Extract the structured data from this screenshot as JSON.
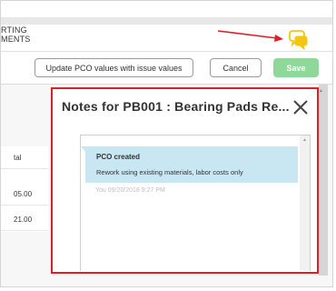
{
  "header": {
    "nav_line_1": "RTING",
    "nav_line_2": "MENTS"
  },
  "toolbar": {
    "update_label": "Update PCO values with issue values",
    "cancel_label": "Cancel",
    "save_label": "Save"
  },
  "background_table": {
    "header": "tal",
    "rows": [
      "05.00",
      "21.00"
    ]
  },
  "modal": {
    "title": "Notes for PB001 : Bearing Pads Re...",
    "close_symbol": "×"
  },
  "notes": [
    {
      "title": "PCO created",
      "text": "Rework using existing materials, labor costs only",
      "meta": "You 09/20/2018 9:27 PM"
    }
  ],
  "colors": {
    "highlight_red": "#e01e2a",
    "save_green": "#90d89a",
    "note_blue": "#c9e7f3",
    "chat_icon_yellow": "#f5c60f"
  },
  "icons": {
    "chat": "chat-bubbles-icon",
    "close": "close-icon",
    "annotation": "red-arrow-annotation"
  }
}
